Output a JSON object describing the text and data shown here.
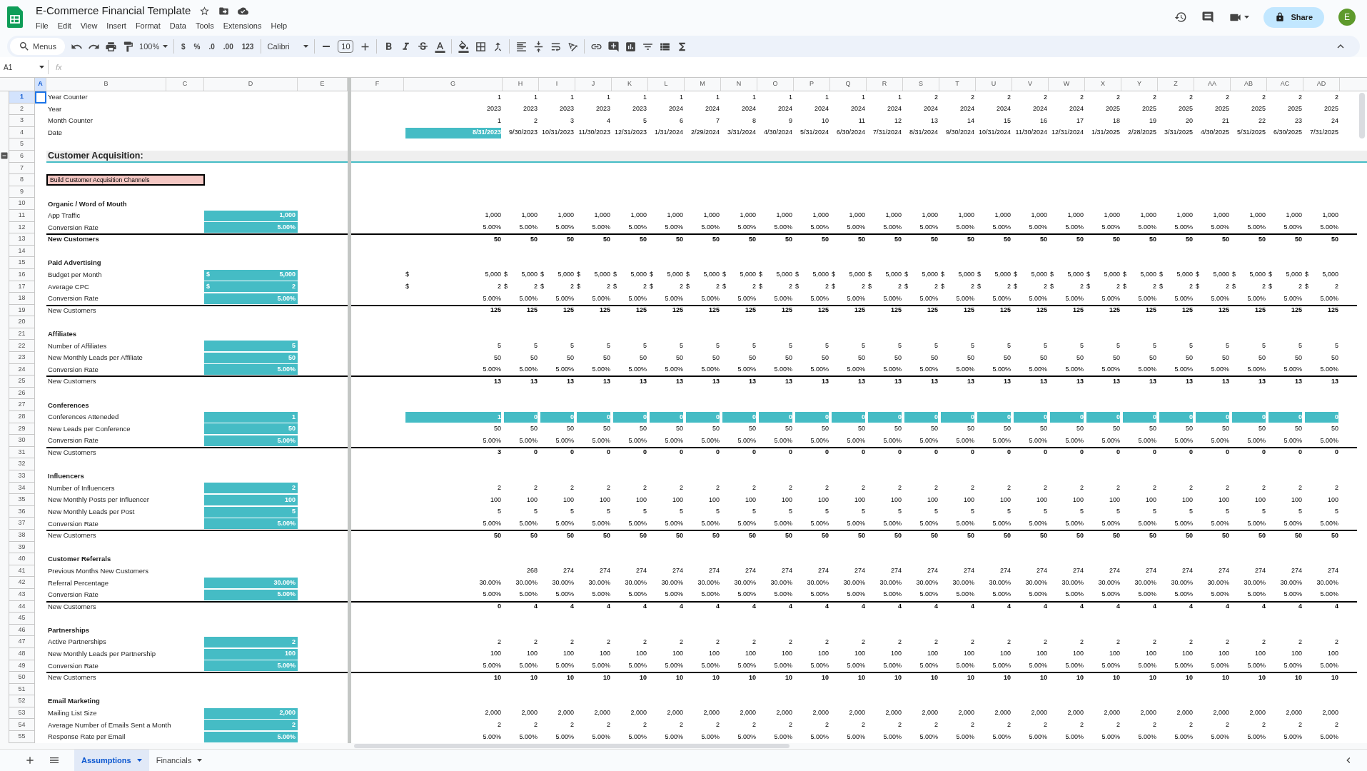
{
  "document": {
    "title": "E-Commerce Financial Template",
    "menus": [
      "File",
      "Edit",
      "View",
      "Insert",
      "Format",
      "Data",
      "Tools",
      "Extensions",
      "Help"
    ],
    "share": "Share",
    "avatar": "E"
  },
  "toolbar": [
    {
      "kind": "search",
      "label": "Menus"
    },
    {
      "kind": "undo"
    },
    {
      "kind": "redo"
    },
    {
      "kind": "print"
    },
    {
      "kind": "paint"
    },
    {
      "kind": "zoom",
      "label": "100%"
    },
    {
      "kind": "sep"
    },
    {
      "kind": "format",
      "label": "$"
    },
    {
      "kind": "format",
      "label": "%"
    },
    {
      "kind": "format",
      "label": ".0"
    },
    {
      "kind": "format",
      "label": ".00"
    },
    {
      "kind": "format",
      "label": "123"
    },
    {
      "kind": "sep"
    },
    {
      "kind": "font",
      "label": "Calibri"
    },
    {
      "kind": "sep"
    },
    {
      "kind": "minus"
    },
    {
      "kind": "size",
      "label": "10"
    },
    {
      "kind": "plus"
    },
    {
      "kind": "sep"
    },
    {
      "kind": "bold"
    },
    {
      "kind": "italic"
    },
    {
      "kind": "strike"
    },
    {
      "kind": "textcolor"
    },
    {
      "kind": "sep"
    },
    {
      "kind": "fill"
    },
    {
      "kind": "borders"
    },
    {
      "kind": "merge"
    },
    {
      "kind": "sep"
    },
    {
      "kind": "halign"
    },
    {
      "kind": "valign"
    },
    {
      "kind": "wrap"
    },
    {
      "kind": "rotate"
    },
    {
      "kind": "sep"
    },
    {
      "kind": "link"
    },
    {
      "kind": "comment"
    },
    {
      "kind": "chart"
    },
    {
      "kind": "filter"
    },
    {
      "kind": "views"
    },
    {
      "kind": "functions"
    }
  ],
  "formula_bar": {
    "cell": "A1",
    "function_label": "fx"
  },
  "columns": [
    {
      "label": "A",
      "selected": true
    },
    {
      "label": "B",
      "selected": false
    },
    {
      "label": "C",
      "selected": false
    },
    {
      "label": "D",
      "selected": false
    },
    {
      "label": "E",
      "selected": false
    },
    {
      "label": "F",
      "selected": false
    },
    {
      "label": "G",
      "selected": false
    },
    {
      "label": "H",
      "selected": false
    },
    {
      "label": "I",
      "selected": false
    },
    {
      "label": "J",
      "selected": false
    },
    {
      "label": "K",
      "selected": false
    },
    {
      "label": "L",
      "selected": false
    },
    {
      "label": "M",
      "selected": false
    },
    {
      "label": "N",
      "selected": false
    },
    {
      "label": "O",
      "selected": false
    },
    {
      "label": "P",
      "selected": false
    },
    {
      "label": "Q",
      "selected": false
    },
    {
      "label": "R",
      "selected": false
    },
    {
      "label": "S",
      "selected": false
    },
    {
      "label": "T",
      "selected": false
    },
    {
      "label": "U",
      "selected": false
    },
    {
      "label": "V",
      "selected": false
    },
    {
      "label": "W",
      "selected": false
    },
    {
      "label": "X",
      "selected": false
    },
    {
      "label": "Y",
      "selected": false
    },
    {
      "label": "Z",
      "selected": false
    },
    {
      "label": "AA",
      "selected": false
    },
    {
      "label": "AB",
      "selected": false
    },
    {
      "label": "AC",
      "selected": false
    },
    {
      "label": "AD",
      "selected": false
    }
  ],
  "rows": [
    {
      "n": "1",
      "selected": true,
      "kind": "calc",
      "label": "Year Counter",
      "values": [
        "1",
        "1",
        "1",
        "1",
        "1",
        "1",
        "1",
        "1",
        "1",
        "1",
        "1",
        "1",
        "2",
        "2",
        "2",
        "2",
        "2",
        "2",
        "2",
        "2",
        "2",
        "2",
        "2",
        "2"
      ]
    },
    {
      "n": "2",
      "selected": false,
      "kind": "calc",
      "label": "Year",
      "values": [
        "2023",
        "2023",
        "2023",
        "2023",
        "2023",
        "2024",
        "2024",
        "2024",
        "2024",
        "2024",
        "2024",
        "2024",
        "2024",
        "2024",
        "2024",
        "2024",
        "2024",
        "2025",
        "2025",
        "2025",
        "2025",
        "2025",
        "2025",
        "2025"
      ]
    },
    {
      "n": "3",
      "selected": false,
      "kind": "calc",
      "label": "Month Counter",
      "values": [
        "1",
        "2",
        "3",
        "4",
        "5",
        "6",
        "7",
        "8",
        "9",
        "10",
        "11",
        "12",
        "13",
        "14",
        "15",
        "16",
        "17",
        "18",
        "19",
        "20",
        "21",
        "22",
        "23",
        "24"
      ]
    },
    {
      "n": "4",
      "selected": false,
      "kind": "calc",
      "label": "Date",
      "first_highlighted": true,
      "values": [
        "8/31/2023",
        "9/30/2023",
        "10/31/2023",
        "11/30/2023",
        "12/31/2023",
        "1/31/2024",
        "2/29/2024",
        "3/31/2024",
        "4/30/2024",
        "5/31/2024",
        "6/30/2024",
        "7/31/2024",
        "8/31/2024",
        "9/30/2024",
        "10/31/2024",
        "11/30/2024",
        "12/31/2024",
        "1/31/2025",
        "2/28/2025",
        "3/31/2025",
        "4/30/2025",
        "5/31/2025",
        "6/30/2025",
        "7/31/2025"
      ]
    },
    {
      "n": "5",
      "selected": false,
      "kind": "blank"
    },
    {
      "n": "6",
      "selected": false,
      "kind": "section",
      "label": "Customer Acquisition:"
    },
    {
      "n": "7",
      "selected": false,
      "kind": "blank"
    },
    {
      "n": "8",
      "selected": false,
      "kind": "action",
      "label": "Build Customer Acquisition Channels"
    },
    {
      "n": "9",
      "selected": false,
      "kind": "blank"
    },
    {
      "n": "10",
      "selected": false,
      "kind": "group",
      "label": "Organic / Word of Mouth"
    },
    {
      "n": "11",
      "selected": false,
      "kind": "input",
      "label": "App Traffic",
      "input": "1,000",
      "values": [
        "1,000",
        "1,000",
        "1,000",
        "1,000",
        "1,000",
        "1,000",
        "1,000",
        "1,000",
        "1,000",
        "1,000",
        "1,000",
        "1,000",
        "1,000",
        "1,000",
        "1,000",
        "1,000",
        "1,000",
        "1,000",
        "1,000",
        "1,000",
        "1,000",
        "1,000",
        "1,000",
        "1,000"
      ]
    },
    {
      "n": "12",
      "selected": false,
      "kind": "input",
      "label": "Conversion Rate",
      "input": "5.00%",
      "values": [
        "5.00%",
        "5.00%",
        "5.00%",
        "5.00%",
        "5.00%",
        "5.00%",
        "5.00%",
        "5.00%",
        "5.00%",
        "5.00%",
        "5.00%",
        "5.00%",
        "5.00%",
        "5.00%",
        "5.00%",
        "5.00%",
        "5.00%",
        "5.00%",
        "5.00%",
        "5.00%",
        "5.00%",
        "5.00%",
        "5.00%",
        "5.00%"
      ]
    },
    {
      "n": "13",
      "selected": false,
      "kind": "total",
      "bold_label": true,
      "label": "New Customers",
      "values": [
        "50",
        "50",
        "50",
        "50",
        "50",
        "50",
        "50",
        "50",
        "50",
        "50",
        "50",
        "50",
        "50",
        "50",
        "50",
        "50",
        "50",
        "50",
        "50",
        "50",
        "50",
        "50",
        "50",
        "50"
      ]
    },
    {
      "n": "14",
      "selected": false,
      "kind": "blank"
    },
    {
      "n": "15",
      "selected": false,
      "kind": "group",
      "label": "Paid Advertising"
    },
    {
      "n": "16",
      "selected": false,
      "kind": "input",
      "label": "Budget per Month",
      "input_symbol": "$",
      "input": "5,000",
      "symbols": [
        "$",
        "$",
        "$",
        "$",
        "$",
        "$",
        "$",
        "$",
        "$",
        "$",
        "$",
        "$",
        "$",
        "$",
        "$",
        "$",
        "$",
        "$",
        "$",
        "$",
        "$",
        "$",
        "$",
        "$"
      ],
      "values": [
        "5,000",
        "5,000",
        "5,000",
        "5,000",
        "5,000",
        "5,000",
        "5,000",
        "5,000",
        "5,000",
        "5,000",
        "5,000",
        "5,000",
        "5,000",
        "5,000",
        "5,000",
        "5,000",
        "5,000",
        "5,000",
        "5,000",
        "5,000",
        "5,000",
        "5,000",
        "5,000",
        "5,000"
      ]
    },
    {
      "n": "17",
      "selected": false,
      "kind": "input",
      "label": "Average CPC",
      "input_symbol": "$",
      "input": "2",
      "symbols": [
        "$",
        "$",
        "$",
        "$",
        "$",
        "$",
        "$",
        "$",
        "$",
        "$",
        "$",
        "$",
        "$",
        "$",
        "$",
        "$",
        "$",
        "$",
        "$",
        "$",
        "$",
        "$",
        "$",
        "$"
      ],
      "values": [
        "2",
        "2",
        "2",
        "2",
        "2",
        "2",
        "2",
        "2",
        "2",
        "2",
        "2",
        "2",
        "2",
        "2",
        "2",
        "2",
        "2",
        "2",
        "2",
        "2",
        "2",
        "2",
        "2",
        "2"
      ]
    },
    {
      "n": "18",
      "selected": false,
      "kind": "input",
      "label": "Conversion Rate",
      "input": "5.00%",
      "values": [
        "5.00%",
        "5.00%",
        "5.00%",
        "5.00%",
        "5.00%",
        "5.00%",
        "5.00%",
        "5.00%",
        "5.00%",
        "5.00%",
        "5.00%",
        "5.00%",
        "5.00%",
        "5.00%",
        "5.00%",
        "5.00%",
        "5.00%",
        "5.00%",
        "5.00%",
        "5.00%",
        "5.00%",
        "5.00%",
        "5.00%",
        "5.00%"
      ]
    },
    {
      "n": "19",
      "selected": false,
      "kind": "total",
      "bold_label": false,
      "label": "New Customers",
      "values": [
        "125",
        "125",
        "125",
        "125",
        "125",
        "125",
        "125",
        "125",
        "125",
        "125",
        "125",
        "125",
        "125",
        "125",
        "125",
        "125",
        "125",
        "125",
        "125",
        "125",
        "125",
        "125",
        "125",
        "125"
      ]
    },
    {
      "n": "20",
      "selected": false,
      "kind": "blank"
    },
    {
      "n": "21",
      "selected": false,
      "kind": "group",
      "label": "Affiliates"
    },
    {
      "n": "22",
      "selected": false,
      "kind": "input",
      "label": "Number of Affiliates",
      "input": "5",
      "values": [
        "5",
        "5",
        "5",
        "5",
        "5",
        "5",
        "5",
        "5",
        "5",
        "5",
        "5",
        "5",
        "5",
        "5",
        "5",
        "5",
        "5",
        "5",
        "5",
        "5",
        "5",
        "5",
        "5",
        "5"
      ]
    },
    {
      "n": "23",
      "selected": false,
      "kind": "input",
      "label": "New Monthly Leads per Affiliate",
      "input": "50",
      "values": [
        "50",
        "50",
        "50",
        "50",
        "50",
        "50",
        "50",
        "50",
        "50",
        "50",
        "50",
        "50",
        "50",
        "50",
        "50",
        "50",
        "50",
        "50",
        "50",
        "50",
        "50",
        "50",
        "50",
        "50"
      ]
    },
    {
      "n": "24",
      "selected": false,
      "kind": "input",
      "label": "Conversion Rate",
      "input": "5.00%",
      "values": [
        "5.00%",
        "5.00%",
        "5.00%",
        "5.00%",
        "5.00%",
        "5.00%",
        "5.00%",
        "5.00%",
        "5.00%",
        "5.00%",
        "5.00%",
        "5.00%",
        "5.00%",
        "5.00%",
        "5.00%",
        "5.00%",
        "5.00%",
        "5.00%",
        "5.00%",
        "5.00%",
        "5.00%",
        "5.00%",
        "5.00%",
        "5.00%"
      ]
    },
    {
      "n": "25",
      "selected": false,
      "kind": "total",
      "bold_label": false,
      "label": "New Customers",
      "values": [
        "13",
        "13",
        "13",
        "13",
        "13",
        "13",
        "13",
        "13",
        "13",
        "13",
        "13",
        "13",
        "13",
        "13",
        "13",
        "13",
        "13",
        "13",
        "13",
        "13",
        "13",
        "13",
        "13",
        "13"
      ]
    },
    {
      "n": "26",
      "selected": false,
      "kind": "blank"
    },
    {
      "n": "27",
      "selected": false,
      "kind": "group",
      "label": "Conferences"
    },
    {
      "n": "28",
      "selected": false,
      "kind": "input",
      "label": "Conferences Atteneded",
      "input": "1",
      "all_highlighted": true,
      "values": [
        "1",
        "0",
        "0",
        "0",
        "0",
        "0",
        "0",
        "0",
        "0",
        "0",
        "0",
        "0",
        "0",
        "0",
        "0",
        "0",
        "0",
        "0",
        "0",
        "0",
        "0",
        "0",
        "0",
        "0"
      ]
    },
    {
      "n": "29",
      "selected": false,
      "kind": "input",
      "label": "New Leads per Conference",
      "input": "50",
      "values": [
        "50",
        "50",
        "50",
        "50",
        "50",
        "50",
        "50",
        "50",
        "50",
        "50",
        "50",
        "50",
        "50",
        "50",
        "50",
        "50",
        "50",
        "50",
        "50",
        "50",
        "50",
        "50",
        "50",
        "50"
      ]
    },
    {
      "n": "30",
      "selected": false,
      "kind": "input",
      "label": "Conversion Rate",
      "input": "5.00%",
      "values": [
        "5.00%",
        "5.00%",
        "5.00%",
        "5.00%",
        "5.00%",
        "5.00%",
        "5.00%",
        "5.00%",
        "5.00%",
        "5.00%",
        "5.00%",
        "5.00%",
        "5.00%",
        "5.00%",
        "5.00%",
        "5.00%",
        "5.00%",
        "5.00%",
        "5.00%",
        "5.00%",
        "5.00%",
        "5.00%",
        "5.00%",
        "5.00%"
      ]
    },
    {
      "n": "31",
      "selected": false,
      "kind": "total",
      "bold_label": false,
      "label": "New Customers",
      "values": [
        "3",
        "0",
        "0",
        "0",
        "0",
        "0",
        "0",
        "0",
        "0",
        "0",
        "0",
        "0",
        "0",
        "0",
        "0",
        "0",
        "0",
        "0",
        "0",
        "0",
        "0",
        "0",
        "0",
        "0"
      ]
    },
    {
      "n": "32",
      "selected": false,
      "kind": "blank"
    },
    {
      "n": "33",
      "selected": false,
      "kind": "group",
      "label": "Influencers"
    },
    {
      "n": "34",
      "selected": false,
      "kind": "input",
      "label": "Number of Influencers",
      "input": "2",
      "values": [
        "2",
        "2",
        "2",
        "2",
        "2",
        "2",
        "2",
        "2",
        "2",
        "2",
        "2",
        "2",
        "2",
        "2",
        "2",
        "2",
        "2",
        "2",
        "2",
        "2",
        "2",
        "2",
        "2",
        "2"
      ]
    },
    {
      "n": "35",
      "selected": false,
      "kind": "input",
      "label": "New Monthly Posts per Influencer",
      "input": "100",
      "values": [
        "100",
        "100",
        "100",
        "100",
        "100",
        "100",
        "100",
        "100",
        "100",
        "100",
        "100",
        "100",
        "100",
        "100",
        "100",
        "100",
        "100",
        "100",
        "100",
        "100",
        "100",
        "100",
        "100",
        "100"
      ]
    },
    {
      "n": "36",
      "selected": false,
      "kind": "input",
      "label": "New Monthly Leads per Post",
      "input": "5",
      "values": [
        "5",
        "5",
        "5",
        "5",
        "5",
        "5",
        "5",
        "5",
        "5",
        "5",
        "5",
        "5",
        "5",
        "5",
        "5",
        "5",
        "5",
        "5",
        "5",
        "5",
        "5",
        "5",
        "5",
        "5"
      ]
    },
    {
      "n": "37",
      "selected": false,
      "kind": "input",
      "label": "Conversion Rate",
      "input": "5.00%",
      "values": [
        "5.00%",
        "5.00%",
        "5.00%",
        "5.00%",
        "5.00%",
        "5.00%",
        "5.00%",
        "5.00%",
        "5.00%",
        "5.00%",
        "5.00%",
        "5.00%",
        "5.00%",
        "5.00%",
        "5.00%",
        "5.00%",
        "5.00%",
        "5.00%",
        "5.00%",
        "5.00%",
        "5.00%",
        "5.00%",
        "5.00%",
        "5.00%"
      ]
    },
    {
      "n": "38",
      "selected": false,
      "kind": "total",
      "bold_label": false,
      "label": "New Customers",
      "values": [
        "50",
        "50",
        "50",
        "50",
        "50",
        "50",
        "50",
        "50",
        "50",
        "50",
        "50",
        "50",
        "50",
        "50",
        "50",
        "50",
        "50",
        "50",
        "50",
        "50",
        "50",
        "50",
        "50",
        "50"
      ]
    },
    {
      "n": "39",
      "selected": false,
      "kind": "blank"
    },
    {
      "n": "40",
      "selected": false,
      "kind": "group",
      "label": "Customer Referrals"
    },
    {
      "n": "41",
      "selected": false,
      "kind": "calc",
      "label": "Previous Months New Customers",
      "first_month_empty": true,
      "values": [
        "268",
        "274",
        "274",
        "274",
        "274",
        "274",
        "274",
        "274",
        "274",
        "274",
        "274",
        "274",
        "274",
        "274",
        "274",
        "274",
        "274",
        "274",
        "274",
        "274",
        "274",
        "274",
        "274"
      ]
    },
    {
      "n": "42",
      "selected": false,
      "kind": "input",
      "label": "Referral Percentage",
      "input": "30.00%",
      "values": [
        "30.00%",
        "30.00%",
        "30.00%",
        "30.00%",
        "30.00%",
        "30.00%",
        "30.00%",
        "30.00%",
        "30.00%",
        "30.00%",
        "30.00%",
        "30.00%",
        "30.00%",
        "30.00%",
        "30.00%",
        "30.00%",
        "30.00%",
        "30.00%",
        "30.00%",
        "30.00%",
        "30.00%",
        "30.00%",
        "30.00%",
        "30.00%"
      ]
    },
    {
      "n": "43",
      "selected": false,
      "kind": "input",
      "label": "Conversion Rate",
      "input": "5.00%",
      "values": [
        "5.00%",
        "5.00%",
        "5.00%",
        "5.00%",
        "5.00%",
        "5.00%",
        "5.00%",
        "5.00%",
        "5.00%",
        "5.00%",
        "5.00%",
        "5.00%",
        "5.00%",
        "5.00%",
        "5.00%",
        "5.00%",
        "5.00%",
        "5.00%",
        "5.00%",
        "5.00%",
        "5.00%",
        "5.00%",
        "5.00%",
        "5.00%"
      ]
    },
    {
      "n": "44",
      "selected": false,
      "kind": "total",
      "bold_label": false,
      "label": "New Customers",
      "values": [
        "0",
        "4",
        "4",
        "4",
        "4",
        "4",
        "4",
        "4",
        "4",
        "4",
        "4",
        "4",
        "4",
        "4",
        "4",
        "4",
        "4",
        "4",
        "4",
        "4",
        "4",
        "4",
        "4",
        "4"
      ]
    },
    {
      "n": "45",
      "selected": false,
      "kind": "blank"
    },
    {
      "n": "46",
      "selected": false,
      "kind": "group",
      "label": "Partnerships"
    },
    {
      "n": "47",
      "selected": false,
      "kind": "input",
      "label": "Active Partnerships",
      "input": "2",
      "values": [
        "2",
        "2",
        "2",
        "2",
        "2",
        "2",
        "2",
        "2",
        "2",
        "2",
        "2",
        "2",
        "2",
        "2",
        "2",
        "2",
        "2",
        "2",
        "2",
        "2",
        "2",
        "2",
        "2",
        "2"
      ]
    },
    {
      "n": "48",
      "selected": false,
      "kind": "input",
      "label": "New Monthly Leads per Partnership",
      "input": "100",
      "values": [
        "100",
        "100",
        "100",
        "100",
        "100",
        "100",
        "100",
        "100",
        "100",
        "100",
        "100",
        "100",
        "100",
        "100",
        "100",
        "100",
        "100",
        "100",
        "100",
        "100",
        "100",
        "100",
        "100",
        "100"
      ]
    },
    {
      "n": "49",
      "selected": false,
      "kind": "input",
      "label": "Conversion Rate",
      "input": "5.00%",
      "values": [
        "5.00%",
        "5.00%",
        "5.00%",
        "5.00%",
        "5.00%",
        "5.00%",
        "5.00%",
        "5.00%",
        "5.00%",
        "5.00%",
        "5.00%",
        "5.00%",
        "5.00%",
        "5.00%",
        "5.00%",
        "5.00%",
        "5.00%",
        "5.00%",
        "5.00%",
        "5.00%",
        "5.00%",
        "5.00%",
        "5.00%",
        "5.00%"
      ]
    },
    {
      "n": "50",
      "selected": false,
      "kind": "total",
      "bold_label": false,
      "label": "New Customers",
      "values": [
        "10",
        "10",
        "10",
        "10",
        "10",
        "10",
        "10",
        "10",
        "10",
        "10",
        "10",
        "10",
        "10",
        "10",
        "10",
        "10",
        "10",
        "10",
        "10",
        "10",
        "10",
        "10",
        "10",
        "10"
      ]
    },
    {
      "n": "51",
      "selected": false,
      "kind": "blank"
    },
    {
      "n": "52",
      "selected": false,
      "kind": "group",
      "label": "Email Marketing"
    },
    {
      "n": "53",
      "selected": false,
      "kind": "input",
      "label": "Mailing List Size",
      "input": "2,000",
      "values": [
        "2,000",
        "2,000",
        "2,000",
        "2,000",
        "2,000",
        "2,000",
        "2,000",
        "2,000",
        "2,000",
        "2,000",
        "2,000",
        "2,000",
        "2,000",
        "2,000",
        "2,000",
        "2,000",
        "2,000",
        "2,000",
        "2,000",
        "2,000",
        "2,000",
        "2,000",
        "2,000",
        "2,000"
      ]
    },
    {
      "n": "54",
      "selected": false,
      "kind": "input",
      "label": "Average Number of Emails Sent a Month",
      "input": "2",
      "values": [
        "2",
        "2",
        "2",
        "2",
        "2",
        "2",
        "2",
        "2",
        "2",
        "2",
        "2",
        "2",
        "2",
        "2",
        "2",
        "2",
        "2",
        "2",
        "2",
        "2",
        "2",
        "2",
        "2",
        "2"
      ]
    },
    {
      "n": "55",
      "selected": false,
      "kind": "input",
      "label": "Response Rate per Email",
      "input": "5.00%",
      "values": [
        "5.00%",
        "5.00%",
        "5.00%",
        "5.00%",
        "5.00%",
        "5.00%",
        "5.00%",
        "5.00%",
        "5.00%",
        "5.00%",
        "5.00%",
        "5.00%",
        "5.00%",
        "5.00%",
        "5.00%",
        "5.00%",
        "5.00%",
        "5.00%",
        "5.00%",
        "5.00%",
        "5.00%",
        "5.00%",
        "5.00%",
        "5.00%"
      ]
    }
  ],
  "sheet_tabs": [
    {
      "label": "Assumptions",
      "selected": true
    },
    {
      "label": "Financials",
      "selected": false
    }
  ]
}
